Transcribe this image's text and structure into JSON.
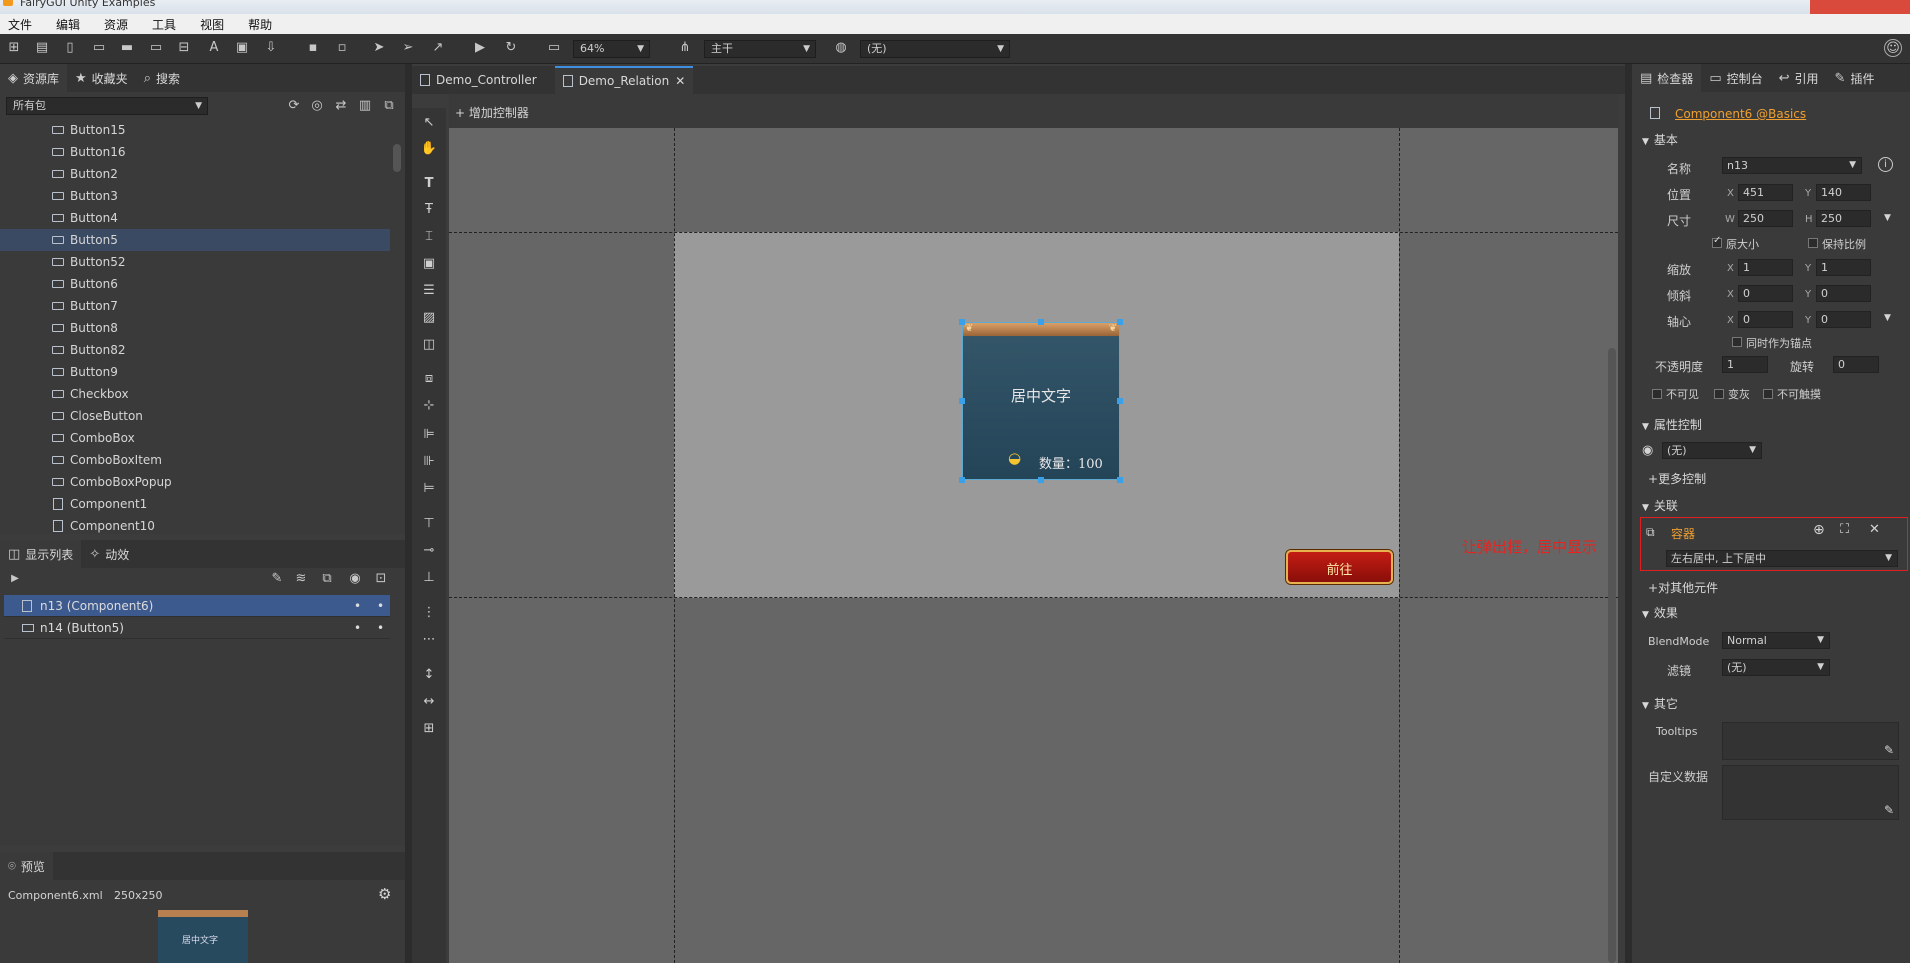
{
  "window": {
    "title": "FairyGUI Unity Examples"
  },
  "menu": [
    "文件",
    "编辑",
    "资源",
    "工具",
    "视图",
    "帮助"
  ],
  "toolbar": {
    "zoom": "64%",
    "branch": "主干",
    "language": "(无)"
  },
  "left_tabs": {
    "library": "资源库",
    "favorites": "收藏夹",
    "search": "搜索"
  },
  "package_filter": "所有包",
  "library_items": [
    "Button15",
    "Button16",
    "Button2",
    "Button3",
    "Button4",
    "Button5",
    "Button52",
    "Button6",
    "Button7",
    "Button8",
    "Button82",
    "Button9",
    "Checkbox",
    "CloseButton",
    "ComboBox",
    "ComboBoxItem",
    "ComboBoxPopup",
    "Component1",
    "Component10"
  ],
  "library_selected": "Button5",
  "display_tabs": {
    "display_list": "显示列表",
    "animation": "动效"
  },
  "display_list": [
    {
      "label": "n13 (Component6)",
      "selected": true
    },
    {
      "label": "n14 (Button5)",
      "selected": false
    }
  ],
  "preview": {
    "tab": "预览",
    "file": "Component6.xml",
    "size": "250x250",
    "thumb_text": "居中文字"
  },
  "doc_tabs": [
    {
      "label": "Demo_Controller",
      "active": false
    },
    {
      "label": "Demo_Relation",
      "active": true
    }
  ],
  "add_controller": "增加控制器",
  "stage": {
    "component_text": "居中文字",
    "quantity_text": "数量：100",
    "button_label": "前往",
    "annotation": "让弹出框，居中显示"
  },
  "inspector": {
    "tabs": {
      "inspector": "检查器",
      "console": "控制台",
      "reference": "引用",
      "plugins": "插件"
    },
    "component_link": "Component6 @Basics",
    "basic_section": "基本",
    "name_label": "名称",
    "name_value": "n13",
    "position_label": "位置",
    "pos_x": "451",
    "pos_y": "140",
    "size_label": "尺寸",
    "size_w": "250",
    "size_h": "250",
    "original_size": "原大小",
    "keep_ratio": "保持比例",
    "scale_label": "缩放",
    "scale_x": "1",
    "scale_y": "1",
    "skew_label": "倾斜",
    "skew_x": "0",
    "skew_y": "0",
    "pivot_label": "轴心",
    "pivot_x": "0",
    "pivot_y": "0",
    "as_anchor": "同时作为锚点",
    "opacity_label": "不透明度",
    "opacity_value": "1",
    "rotation_label": "旋转",
    "rotation_value": "0",
    "invisible": "不可见",
    "gray": "变灰",
    "untouchable": "不可触摸",
    "gear_section": "属性控制",
    "gear_value": "(无)",
    "more_controls": "更多控制",
    "relation_section": "关联",
    "relation_target": "容器",
    "relation_value": "左右居中, 上下居中",
    "relate_other": "对其他元件",
    "effects_section": "效果",
    "blend_label": "BlendMode",
    "blend_value": "Normal",
    "filter_label": "滤镜",
    "filter_value": "(无)",
    "other_section": "其它",
    "tooltips_label": "Tooltips",
    "custom_data_label": "自定义数据",
    "axis_x": "X",
    "axis_y": "Y",
    "axis_w": "W",
    "axis_h": "H"
  },
  "colors": {
    "accent": "#3d5a8f",
    "link": "#f0a030",
    "annotation": "#e8231f",
    "relation_border": "#e02020"
  }
}
